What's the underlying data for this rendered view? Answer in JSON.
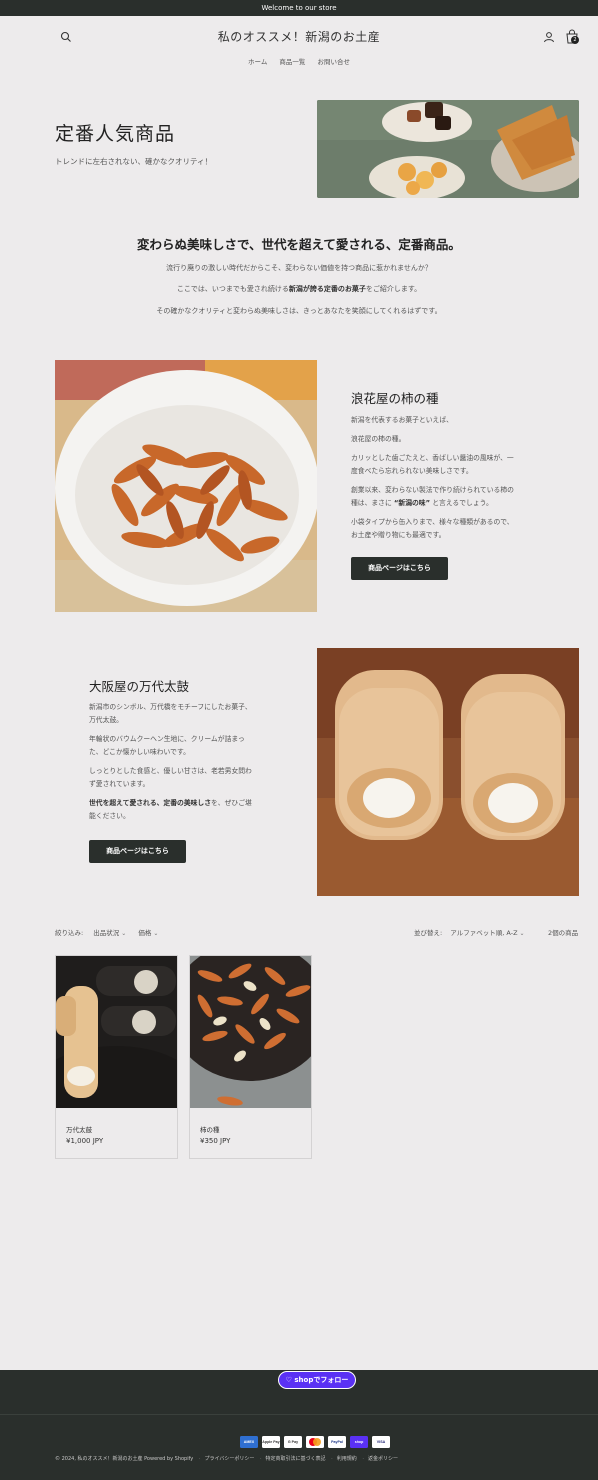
{
  "announcement": "Welcome to our store",
  "header": {
    "title": "私のオススメ！新潟のお土産",
    "cart_count": "2",
    "nav": [
      "ホーム",
      "商品一覧",
      "お問い合せ"
    ]
  },
  "hero": {
    "title": "定番人気商品",
    "subtitle": "トレンドに左右されない、確かなクオリティ！"
  },
  "intro": {
    "heading": "変わらぬ美味しさで、世代を超えて愛される、定番商品。",
    "line1": "流行り廃りの激しい時代だからこそ、変わらない価値を持つ商品に惹かれませんか？",
    "line2_pre": "ここでは、いつまでも愛され続ける",
    "line2_bold": "新潟が誇る定番のお菓子",
    "line2_post": "をご紹介します。",
    "line3": "その確かなクオリティと変わらぬ美味しさは、きっとあなたを笑顔にしてくれるはずです。"
  },
  "feature1": {
    "title": "浪花屋の柿の種",
    "p1": "新潟を代表するお菓子といえば、",
    "p2": "浪花屋の柿の種。",
    "p3a": "カリッとした歯ごたえと、香ばしい醤油の風味が、一",
    "p3b": "度食べたら忘れられない美味しさです。",
    "p4a": "創業以来、変わらない製法で作り続けられている柿の",
    "p4b_pre": "種は、まさに ",
    "p4b_bold": "“新潟の味”",
    "p4b_post": " と言えるでしょう。",
    "p5a": "小袋タイプから缶入りまで、様々な種類があるので、",
    "p5b": "お土産や贈り物にも最適です。",
    "button": "商品ページはこちら"
  },
  "feature2": {
    "title": "大阪屋の万代太鼓",
    "p1a": "新潟市のシンボル、万代橋をモチーフにしたお菓子、",
    "p1b": "万代太鼓。",
    "p2a": "年輪状のバウムクーヘン生地に、クリームが詰まっ",
    "p2b": "た、どこか懐かしい味わいです。",
    "p3a": "しっとりとした食感と、優しい甘さは、老若男女問わ",
    "p3b": "ず愛されています。",
    "p4a_bold": "世代を超えて愛される、定番の美味しさ",
    "p4a_post": "を、ぜひご堪",
    "p4b": "能ください。",
    "button": "商品ページはこちら"
  },
  "filters": {
    "label": "絞り込み:",
    "availability": "出品状況",
    "price": "価格",
    "sort_label": "並び替え:",
    "sort_value": "アルファベット順, A-Z",
    "count": "2個の商品"
  },
  "products": [
    {
      "name": "万代太鼓",
      "price": "¥1,000 JPY"
    },
    {
      "name": "柿の種",
      "price": "¥350 JPY"
    }
  ],
  "footer": {
    "shop_follow": "shopでフォロー",
    "payments": [
      "AMEX",
      "Apple Pay",
      "G Pay",
      "MC",
      "PayPal",
      "shop",
      "VISA"
    ],
    "copyright": "© 2024, 私のオススメ！新潟のお土産 Powered by Shopify",
    "links": [
      "プライバシーポリシー",
      "特定商取引法に基づく表記",
      "利用規約",
      "返金ポリシー"
    ]
  },
  "colors": {
    "background": "#edebec",
    "dark": "#2a2f2c",
    "shop_purple": "#5a31f4"
  }
}
